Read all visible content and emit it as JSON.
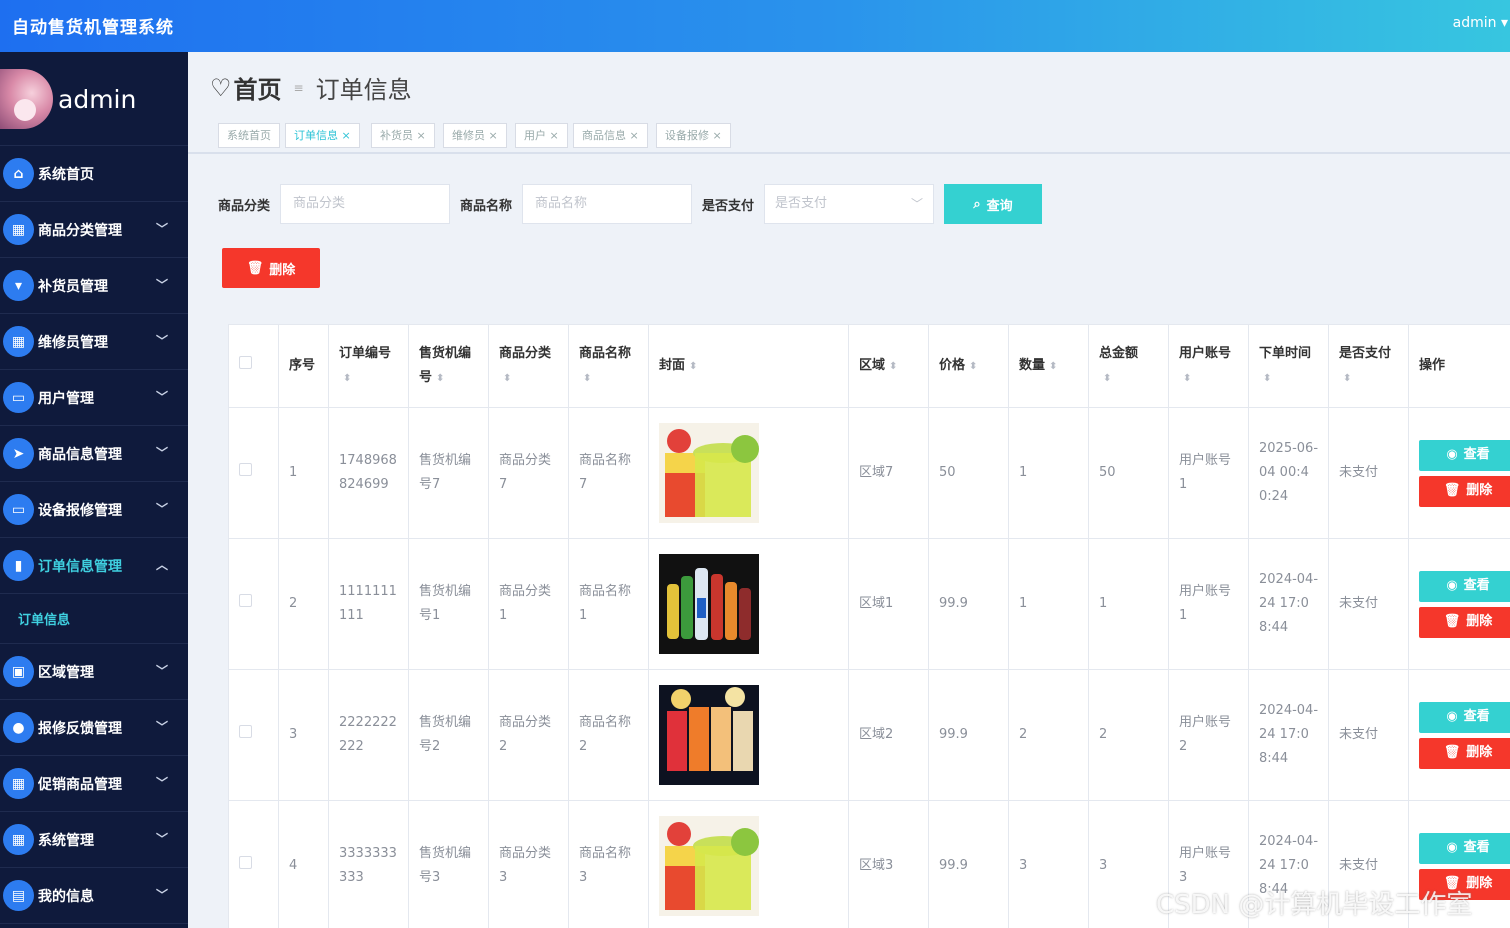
{
  "header": {
    "app_title": "自动售货机管理系统",
    "user": "admin ▾"
  },
  "sidebar": {
    "username": "admin",
    "items": [
      {
        "label": "系统首页",
        "icon": "home-icon",
        "glyph": "⌂",
        "arrow": ""
      },
      {
        "label": "商品分类管理",
        "icon": "grid-icon",
        "glyph": "▦",
        "arrow": "﹀"
      },
      {
        "label": "补货员管理",
        "icon": "brush-icon",
        "glyph": "▾",
        "arrow": "﹀"
      },
      {
        "label": "维修员管理",
        "icon": "grid-icon",
        "glyph": "▦",
        "arrow": "﹀"
      },
      {
        "label": "用户管理",
        "icon": "chat-icon",
        "glyph": "▭",
        "arrow": "﹀"
      },
      {
        "label": "商品信息管理",
        "icon": "send-icon",
        "glyph": "➤",
        "arrow": "﹀"
      },
      {
        "label": "设备报修管理",
        "icon": "monitor-icon",
        "glyph": "▭",
        "arrow": "﹀"
      },
      {
        "label": "订单信息管理",
        "icon": "chart-icon",
        "glyph": "▮",
        "arrow": "︿"
      },
      {
        "label": "区域管理",
        "icon": "briefcase-icon",
        "glyph": "▣",
        "arrow": "﹀"
      },
      {
        "label": "报修反馈管理",
        "icon": "bulb-icon",
        "glyph": "●",
        "arrow": "﹀"
      },
      {
        "label": "促销商品管理",
        "icon": "grid-icon",
        "glyph": "▦",
        "arrow": "﹀"
      },
      {
        "label": "系统管理",
        "icon": "grid-icon",
        "glyph": "▦",
        "arrow": "﹀"
      },
      {
        "label": "我的信息",
        "icon": "card-icon",
        "glyph": "▤",
        "arrow": "﹀"
      }
    ],
    "submenu_label": "订单信息"
  },
  "breadcrumb": {
    "home": "首页",
    "separator": "≡",
    "current": "订单信息"
  },
  "tags": [
    {
      "label": "系统首页"
    },
    {
      "label": "订单信息 ×"
    },
    {
      "label": "补货员 ×"
    },
    {
      "label": "维修员 ×"
    },
    {
      "label": "用户 ×"
    },
    {
      "label": "商品信息 ×"
    },
    {
      "label": "设备报修 ×"
    }
  ],
  "filters": {
    "category_label": "商品分类",
    "category_placeholder": "商品分类",
    "name_label": "商品名称",
    "name_placeholder": "商品名称",
    "paid_label": "是否支付",
    "paid_placeholder": "是否支付",
    "query_button": "查询",
    "delete_button": "删除"
  },
  "table": {
    "columns": [
      "序号",
      "订单编号",
      "售货机编号",
      "商品分类",
      "商品名称",
      "封面",
      "区域",
      "价格",
      "数量",
      "总金额",
      "用户账号",
      "下单时间",
      "是否支付",
      "操作"
    ],
    "view_label": "查看",
    "delete_label": "删除",
    "rows": [
      {
        "no": "1",
        "order_no": "1748968824699",
        "machine": "售货机编号7",
        "category": "商品分类7",
        "name": "商品名称7",
        "cover": "juice-cocktail",
        "area": "区域7",
        "price": "50",
        "qty": "1",
        "total": "50",
        "account": "用户账号1",
        "time": "2025-06-04 00:40:24",
        "paid": "未支付"
      },
      {
        "no": "2",
        "order_no": "1111111111",
        "machine": "售货机编号1",
        "category": "商品分类1",
        "name": "商品名称1",
        "cover": "bottled-drinks",
        "area": "区域1",
        "price": "99.9",
        "qty": "1",
        "total": "1",
        "account": "用户账号1",
        "time": "2024-04-24 17:08:44",
        "paid": "未支付"
      },
      {
        "no": "3",
        "order_no": "2222222222",
        "machine": "售货机编号2",
        "category": "商品分类2",
        "name": "商品名称2",
        "cover": "fruit-juices",
        "area": "区域2",
        "price": "99.9",
        "qty": "2",
        "total": "2",
        "account": "用户账号2",
        "time": "2024-04-24 17:08:44",
        "paid": "未支付"
      },
      {
        "no": "4",
        "order_no": "3333333333",
        "machine": "售货机编号3",
        "category": "商品分类3",
        "name": "商品名称3",
        "cover": "juice-cocktail",
        "area": "区域3",
        "price": "99.9",
        "qty": "3",
        "total": "3",
        "account": "用户账号3",
        "time": "2024-04-24 17:08:44",
        "paid": "未支付"
      }
    ]
  },
  "watermark": "CSDN @计算机毕设工作室"
}
